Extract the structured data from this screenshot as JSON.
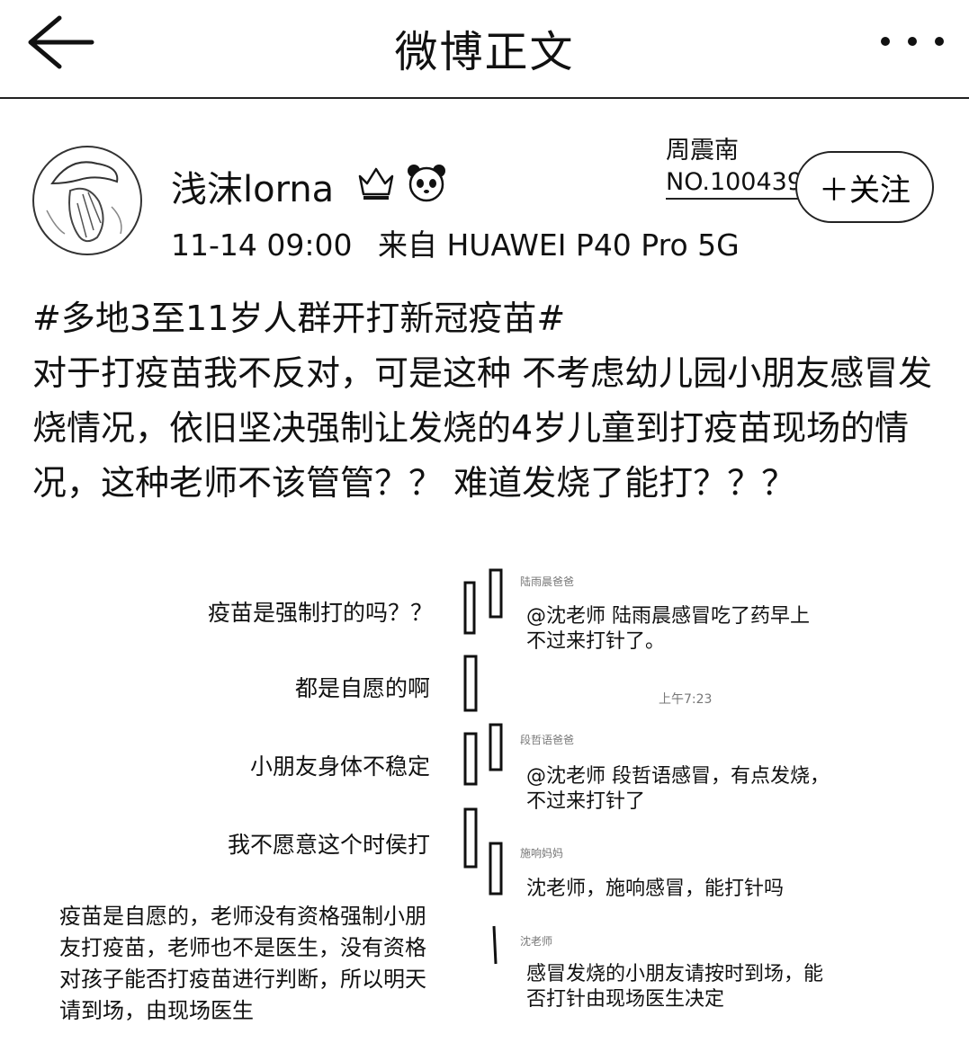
{
  "header": {
    "title": "微博正文",
    "back_icon": "arrow-left-icon",
    "more_icon": "more-dots-icon"
  },
  "post": {
    "author": "浅沫lorna",
    "time": "11-14 09:00",
    "source": "来自 HUAWEI P40 Pro 5G",
    "follow_label": "＋关注",
    "stamp_name": "周震南",
    "stamp_no": "NO.100439",
    "hashtag": "#多地3至11岁人群开打新冠疫苗#",
    "body": "对于打疫苗我不反对，可是这种 不考虑幼儿园小朋友感冒发烧情况，依旧坚决强制让发烧的4岁儿童到打疫苗现场的情况，这种老师不该管管？？ 难道发烧了能打？？？"
  },
  "screenshot": {
    "left_messages": [
      "疫苗是强制打的吗？？",
      "都是自愿的啊",
      "小朋友身体不稳定",
      "我不愿意这个时侯打"
    ],
    "left_paragraph": "疫苗是自愿的，老师没有资格强制小朋友打疫苗，老师也不是医生，没有资格对孩子能否打疫苗进行判断，所以明天请到场，由现场医生",
    "timestamp": "上午7:23",
    "right_messages": [
      {
        "name": "陆雨晨爸爸",
        "text_line1": "@沈老师  陆雨晨感冒吃了药早上",
        "text_line2": "不过来打针了。"
      },
      {
        "name": "段哲语爸爸",
        "text_line1": "@沈老师  段哲语感冒，有点发烧，",
        "text_line2": "不过来打针了"
      },
      {
        "name": "施响妈妈",
        "text_line1": "沈老师，施响感冒，能打针吗",
        "text_line2": ""
      },
      {
        "name": "沈老师",
        "text_line1": "感冒发烧的小朋友请按时到场，能",
        "text_line2": "否打针由现场医生决定"
      }
    ]
  }
}
